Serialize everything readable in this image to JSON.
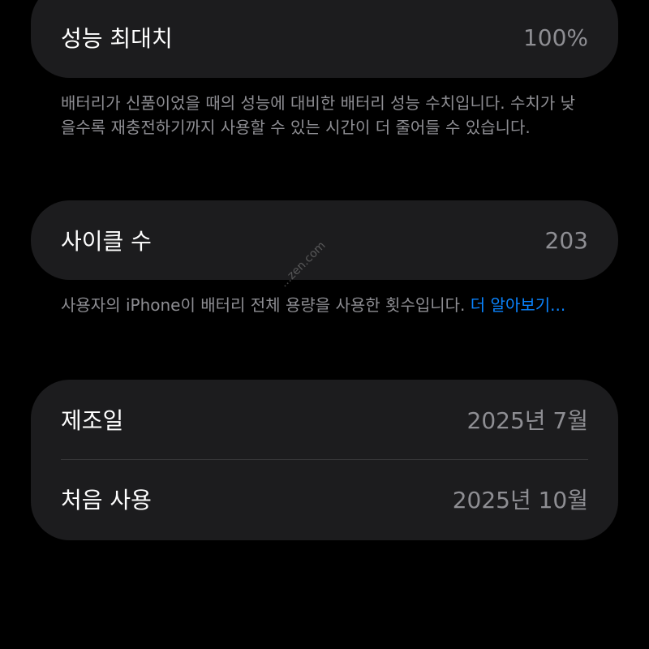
{
  "peak_capacity": {
    "label": "성능 최대치",
    "value": "100%",
    "note": "배터리가 신품이었을 때의 성능에 대비한 배터리 성능 수치입니다. 수치가 낮을수록 재충전하기까지 사용할 수 있는 시간이 더 줄어들 수 있습니다."
  },
  "cycle_count": {
    "label": "사이클 수",
    "value": "203",
    "note": "사용자의 iPhone이 배터리 전체 용량을 사용한 횟수입니다. ",
    "learn_more": "더 알아보기..."
  },
  "dates": {
    "manufacture_label": "제조일",
    "manufacture_value": "2025년 7월",
    "first_use_label": "처음 사용",
    "first_use_value": "2025년 10월"
  },
  "watermark": "...zen.com",
  "colors": {
    "background": "#000000",
    "card": "#1c1c1e",
    "secondary_text": "#8e8e93",
    "link": "#0a84ff",
    "divider": "#38383a"
  }
}
